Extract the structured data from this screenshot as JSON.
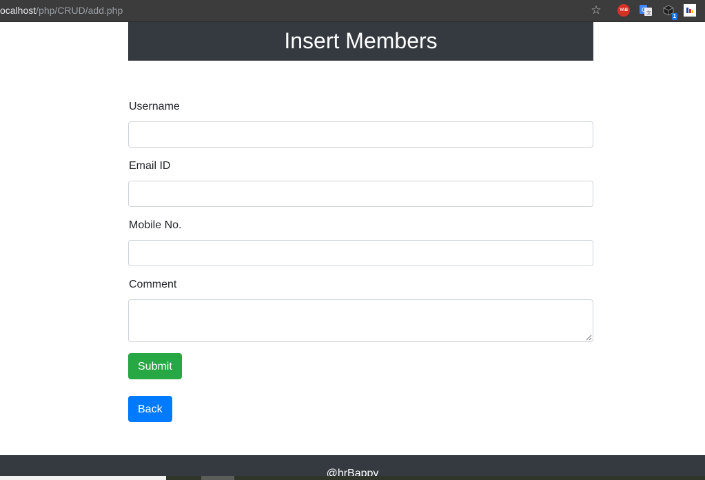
{
  "browser": {
    "url_host": "ocalhost",
    "url_path": "/php/CRUD/add.php",
    "extensions": {
      "yab_label": "YAB",
      "cube_badge": "1"
    }
  },
  "header": {
    "title": "Insert Members"
  },
  "form": {
    "username_label": "Username",
    "username_value": "",
    "email_label": "Email ID",
    "email_value": "",
    "mobile_label": "Mobile No.",
    "mobile_value": "",
    "comment_label": "Comment",
    "comment_value": "",
    "submit_label": "Submit",
    "back_label": "Back"
  },
  "footer": {
    "text": "@hrBappy"
  },
  "colors": {
    "header_bg": "#343a40",
    "submit_bg": "#28a745",
    "back_bg": "#007bff",
    "input_border": "#ced4da"
  }
}
